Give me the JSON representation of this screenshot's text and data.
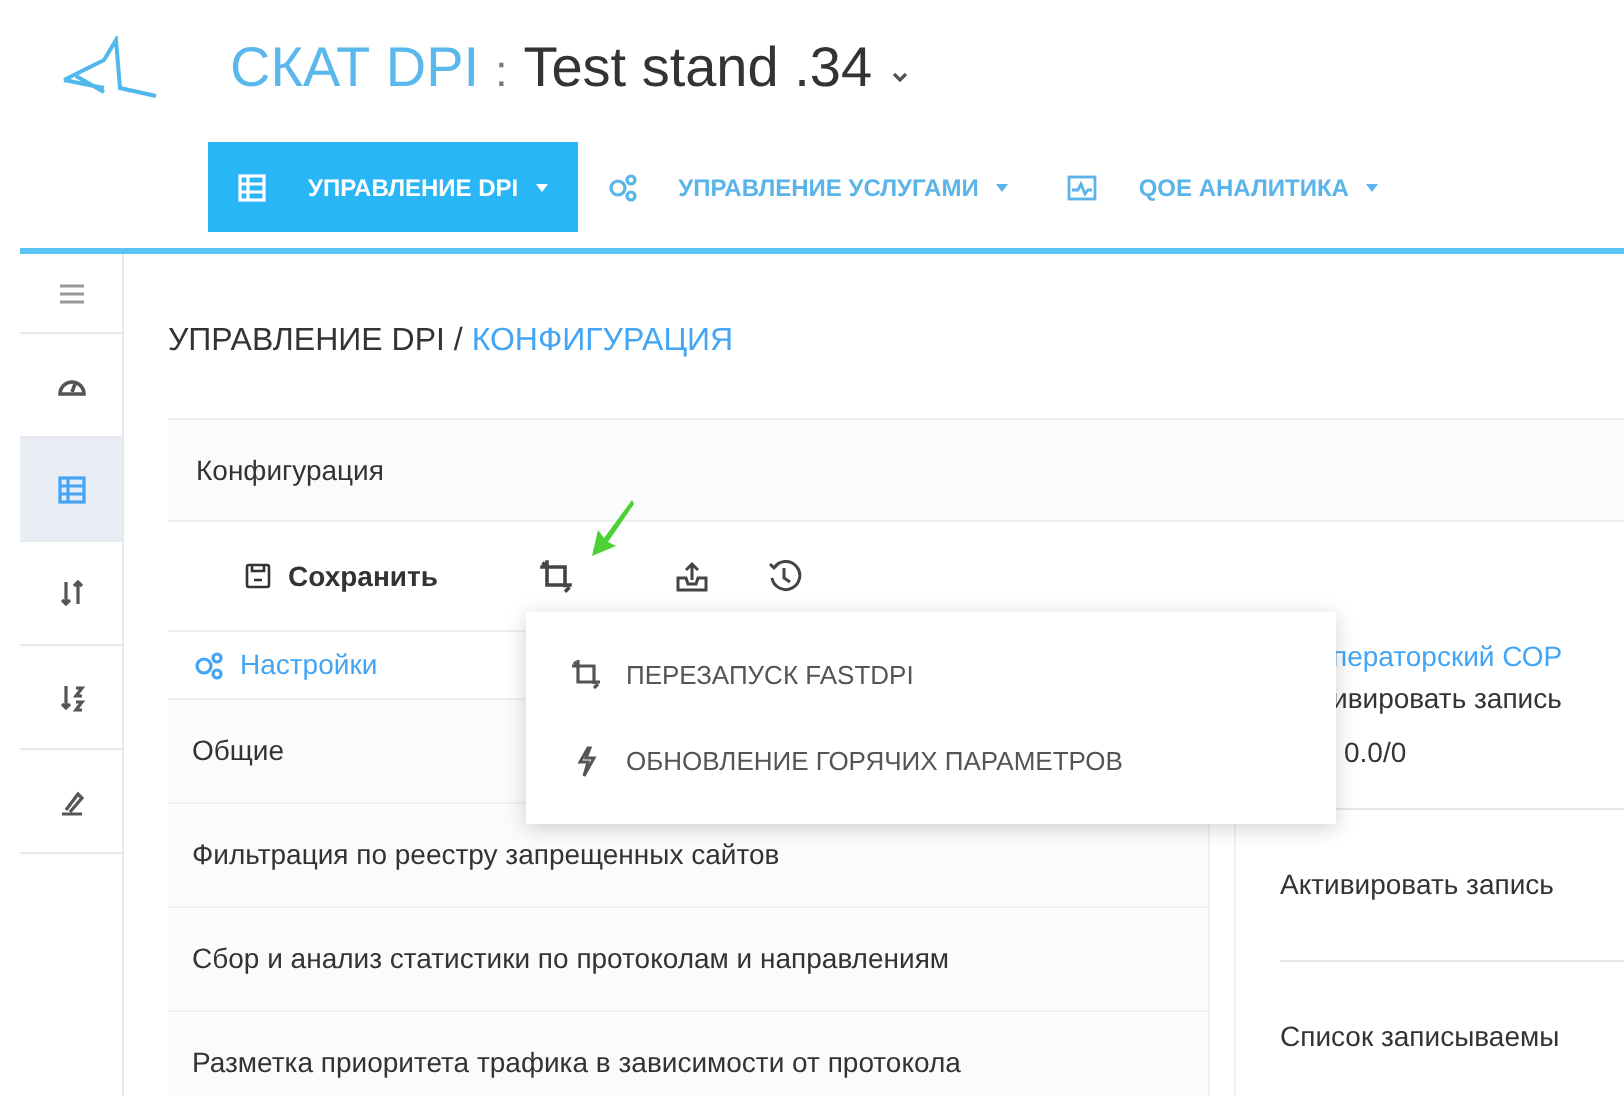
{
  "header": {
    "brand": "СКАТ DPI",
    "separator": ":",
    "title": "Test stand .34"
  },
  "nav": [
    {
      "label": "УПРАВЛЕНИЕ DPI",
      "kind": "table",
      "selected": true
    },
    {
      "label": "УПРАВЛЕНИЕ УСЛУГАМИ",
      "kind": "gears",
      "selected": false
    },
    {
      "label": "QOE АНАЛИТИКА",
      "kind": "chart",
      "selected": false
    }
  ],
  "sidebar": [
    {
      "kind": "menu",
      "selected": false
    },
    {
      "kind": "gauge",
      "selected": false
    },
    {
      "kind": "table",
      "selected": true
    },
    {
      "kind": "sort",
      "selected": false
    },
    {
      "kind": "sort-az",
      "selected": false
    },
    {
      "kind": "tool",
      "selected": false
    }
  ],
  "breadcrumb": {
    "parent": "УПРАВЛЕНИЕ DPI",
    "separator": "/",
    "current": "КОНФИГУРАЦИЯ"
  },
  "card_title": "Конфигурация",
  "toolbar": {
    "save": "Сохранить"
  },
  "settings": {
    "title": "Настройки",
    "items": [
      "Общие",
      "Фильтрация по реестру запрещенных сайтов",
      "Сбор и анализ статистики по протоколам и направлениям",
      "Разметка приоритета трафика в зависимости от протокола"
    ]
  },
  "right_panel": {
    "title": "ператорский СОР",
    "rows": [
      {
        "label": "ивировать запись",
        "value": "0.0/0"
      },
      {
        "label": "Активировать запись"
      },
      {
        "label": "Список записываемы"
      }
    ]
  },
  "menu": [
    {
      "label": "ПЕРЕЗАПУСК FASTDPI",
      "kind": "restart"
    },
    {
      "label": "ОБНОВЛЕНИЕ ГОРЯЧИХ ПАРАМЕТРОВ",
      "kind": "hot"
    }
  ]
}
